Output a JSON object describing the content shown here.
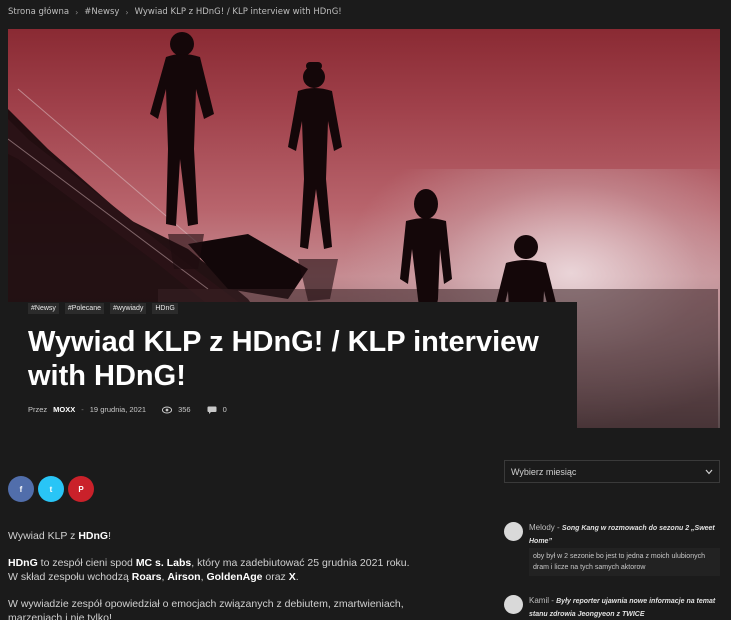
{
  "breadcrumb": {
    "items": [
      "Strona główna",
      "#Newsy",
      "Wywiad KLP z HDnG! / KLP interview with HDnG!"
    ],
    "separator": "›"
  },
  "post": {
    "tags": [
      "#Newsy",
      "#Polecane",
      "#wywiady",
      "HDnG"
    ],
    "title": "Wywiad KLP z HDnG! / KLP interview with HDnG!",
    "meta": {
      "by_label": "Przez",
      "author": "MOXX",
      "separator": "-",
      "date": "19 grudnia, 2021",
      "views": "356",
      "comments": "0"
    }
  },
  "share": {
    "buttons": [
      {
        "icon": "facebook-icon",
        "glyph": "f",
        "color": "#516eab"
      },
      {
        "icon": "twitter-icon",
        "glyph": "t",
        "color": "#29c5f6"
      },
      {
        "icon": "pinterest-icon",
        "glyph": "P",
        "color": "#ca212a"
      }
    ]
  },
  "article": {
    "p1": {
      "a": "Wywiad KLP z ",
      "b": "HDnG",
      "c": "!"
    },
    "p2": {
      "s1": "HDnG",
      "s2": " to zespół cieni spod ",
      "s3": "MC s. Labs",
      "s4": ", który ma zadebiutować 25 grudnia 2021 roku.",
      "s5": "W skład zespołu wchodzą ",
      "s6": "Roars",
      "s7": ", ",
      "s8": "Airson",
      "s9": ", ",
      "s10": "GoldenAge",
      "s11": " oraz ",
      "s12": "X",
      "s13": "."
    },
    "p3": "W wywiadzie zespół opowiedział o emocjach związanych z debiutem, zmartwieniach, marzeniach i nie tylko!"
  },
  "sidebar": {
    "month_select": {
      "value": "Wybierz miesiąc"
    },
    "comments": [
      {
        "author": "Melody",
        "sep": " - ",
        "post": "Song Kang w rozmowach do sezonu 2 „Sweet Home”",
        "excerpt": "oby był w 2 sezonie bo jest to jedna z moich ulubionych dram i licze na tych samych aktorow"
      },
      {
        "author": "Kamil",
        "sep": " - ",
        "post": "Były reporter ujawnia nowe informacje na temat stanu zdrowia Jeongyeon z TWICE",
        "excerpt": ""
      }
    ]
  },
  "colors": {
    "background": "#1b1b1b",
    "facebook": "#516eab",
    "twitter": "#29c5f6",
    "pinterest": "#ca212a"
  }
}
